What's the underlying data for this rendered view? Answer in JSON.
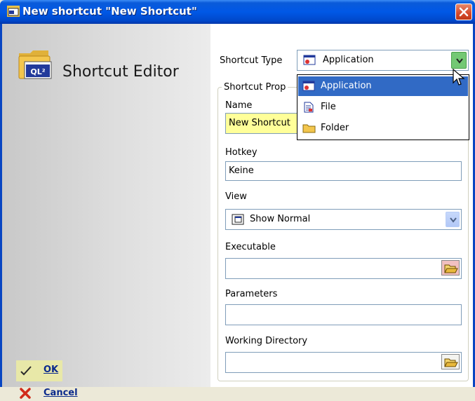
{
  "window": {
    "title": "New shortcut \"New Shortcut\"",
    "title_icon": "ql-app-icon",
    "close_icon": "close-icon"
  },
  "brand": {
    "icon_text": "QL²",
    "title": "Shortcut Editor"
  },
  "actions": {
    "ok_label": "OK",
    "cancel_label": "Cancel"
  },
  "form": {
    "shortcut_type": {
      "label": "Shortcut Type",
      "value": "Application",
      "options": [
        "Application",
        "File",
        "Folder"
      ],
      "highlighted": "Application"
    },
    "group_title": "Shortcut Properties",
    "group_title_visible": "Shortcut Prop",
    "name": {
      "label": "Name",
      "value": "New Shortcut",
      "visible_value": "New Shortcut"
    },
    "hotkey": {
      "label": "Hotkey",
      "value": "Keine"
    },
    "view": {
      "label": "View",
      "value": "Show Normal"
    },
    "executable": {
      "label": "Executable",
      "value": ""
    },
    "parameters": {
      "label": "Parameters",
      "value": ""
    },
    "working_directory": {
      "label": "Working Directory",
      "value": ""
    }
  },
  "colors": {
    "titlebar": "#0058e6",
    "selection": "#316ac5",
    "name_field_bg": "#ffff99",
    "ok_highlight": "#e8e8a8",
    "link": "#0b2a8c"
  }
}
